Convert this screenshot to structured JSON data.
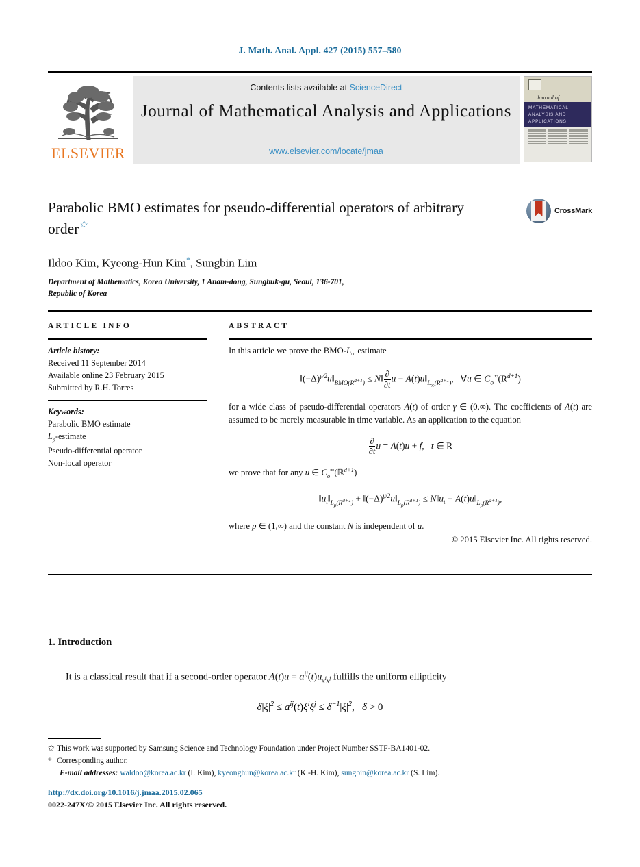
{
  "running_head": "J. Math. Anal. Appl. 427 (2015) 557–580",
  "masthead": {
    "contents_prefix": "Contents lists available at ",
    "sciencedirect": "ScienceDirect",
    "journal_title": "Journal of Mathematical Analysis and Applications",
    "journal_url": "www.elsevier.com/locate/jmaa",
    "publisher_name": "ELSEVIER",
    "cover": {
      "journal_of": "Journal of",
      "line1": "MATHEMATICAL",
      "line2": "ANALYSIS AND",
      "line3": "APPLICATIONS"
    }
  },
  "article": {
    "title": "Parabolic BMO estimates for pseudo-differential operators of arbitrary order",
    "title_footnote_mark": "✩",
    "crossmark_label": "CrossMark",
    "authors": "Ildoo Kim, Kyeong-Hun Kim",
    "authors_corresponding_mark": "*",
    "authors_tail": ", Sungbin Lim",
    "affiliation_line1": "Department of Mathematics, Korea University, 1 Anam-dong, Sungbuk-gu, Seoul, 136-701,",
    "affiliation_line2": "Republic of Korea"
  },
  "article_info": {
    "heading": "ARTICLE INFO",
    "history_label": "Article history:",
    "history": [
      "Received 11 September 2014",
      "Available online 23 February 2015",
      "Submitted by R.H. Torres"
    ],
    "keywords_label": "Keywords:",
    "keywords": [
      "Parabolic BMO estimate",
      "Lp-estimate",
      "Pseudo-differential operator",
      "Non-local operator"
    ]
  },
  "abstract": {
    "heading": "ABSTRACT",
    "intro_line": "In this article we prove the BMO-L∞ estimate",
    "para1": "for a wide class of pseudo-differential operators A(t) of order γ ∈ (0, ∞). The coefficients of A(t) are assumed to be merely measurable in time variable. As an application to the equation",
    "para2": "we prove that for any u ∈ C∞₀(ℝ^{d+1})",
    "para3": "where p ∈ (1, ∞) and the constant N is independent of u.",
    "copyright": "© 2015 Elsevier Inc. All rights reserved."
  },
  "introduction": {
    "heading": "1. Introduction",
    "paragraph": "It is a classical result that if a second-order operator A(t)u = a^{ij}(t)u_{x^i x^j} fulfills the uniform ellipticity"
  },
  "footnotes": {
    "star_mark": "✩",
    "star_text": "This work was supported by Samsung Science and Technology Foundation under Project Number SSTF-BA1401-02.",
    "corresponding_mark": "*",
    "corresponding_text": "Corresponding author.",
    "emails_label": "E-mail addresses:",
    "emails": [
      {
        "address": "waldoo@korea.ac.kr",
        "person": "(I. Kim)"
      },
      {
        "address": "kyeonghun@korea.ac.kr",
        "person": "(K.-H. Kim)"
      },
      {
        "address": "sungbin@korea.ac.kr",
        "person": "(S. Lim)"
      }
    ]
  },
  "footer": {
    "doi": "http://dx.doi.org/10.1016/j.jmaa.2015.02.065",
    "issn_line": "0022-247X/© 2015 Elsevier Inc. All rights reserved."
  },
  "colors": {
    "link": "#1a6b9a",
    "sciencedirect": "#3a8fc4",
    "elsevier_orange": "#E87722",
    "cover_band": "#2e2a5c"
  }
}
